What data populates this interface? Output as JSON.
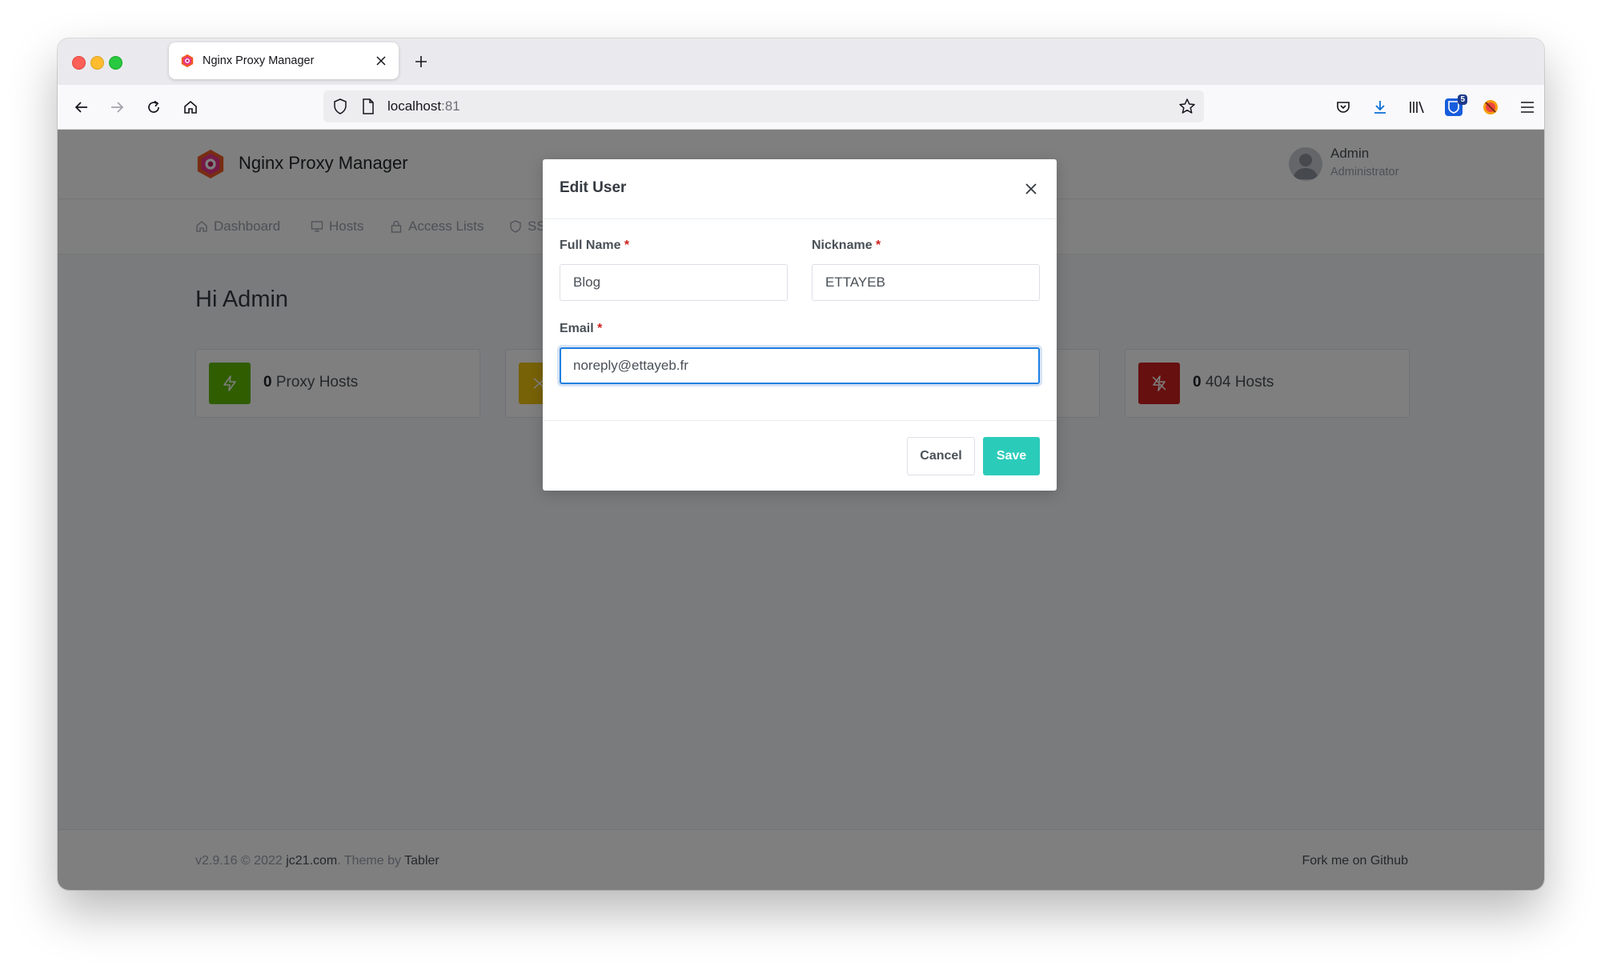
{
  "browser": {
    "tab_title": "Nginx Proxy Manager",
    "url_host": "localhost",
    "url_port": ":81",
    "extension_badge": "5"
  },
  "app": {
    "brand_name": "Nginx Proxy Manager",
    "user": {
      "name": "Admin",
      "role": "Administrator"
    },
    "nav": [
      "Dashboard",
      "Hosts",
      "Access Lists",
      "SSL"
    ],
    "greeting": "Hi Admin",
    "stats": [
      {
        "count": "0",
        "label": "Proxy Hosts",
        "color": "#5eba00",
        "icon": "zap-icon"
      },
      {
        "count": "",
        "label": "",
        "color": "#f1c40f",
        "icon": "shuffle-icon"
      },
      {
        "count": "0",
        "label": "404 Hosts",
        "color": "#cd201f",
        "icon": "zap-off-icon"
      }
    ],
    "footer": {
      "version": "v2.9.16 © 2022",
      "author_link": "jc21.com",
      "theme_text": ". Theme by",
      "theme_link": "Tabler",
      "github_link": "Fork me on Github"
    }
  },
  "modal": {
    "title": "Edit User",
    "full_name_label": "Full Name",
    "full_name_value": "Blog",
    "nickname_label": "Nickname",
    "nickname_value": "ETTAYEB",
    "email_label": "Email",
    "email_value": "noreply@ettayeb.fr",
    "required_mark": "*",
    "cancel_label": "Cancel",
    "save_label": "Save"
  },
  "colors": {
    "accent": "#2bcbba",
    "focus": "#1f7fe0",
    "required": "#cd201f"
  }
}
